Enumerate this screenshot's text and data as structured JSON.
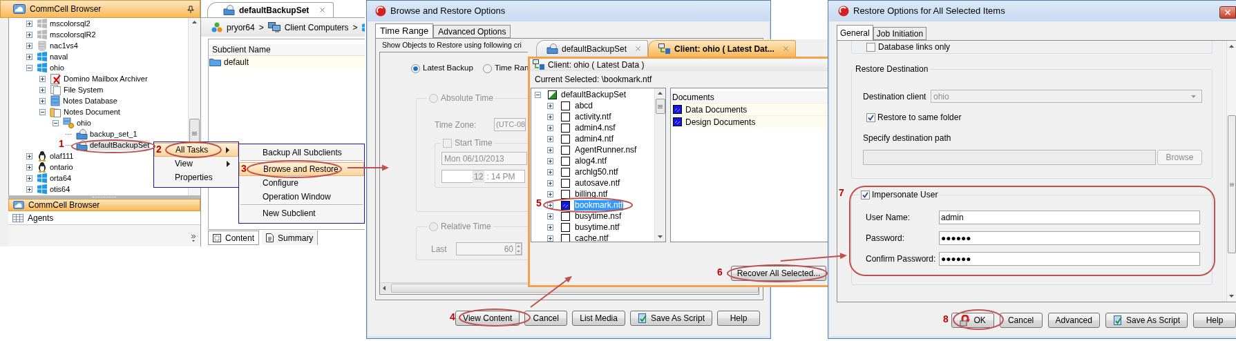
{
  "commcell_browser": {
    "title": "CommCell Browser",
    "tree": [
      {
        "label": "mscolorsql2",
        "kind": "windows-offline",
        "expandable": true,
        "expanded": false,
        "selected": false
      },
      {
        "label": "mscolorsqlR2",
        "kind": "windows-offline",
        "expandable": true,
        "expanded": false,
        "selected": false
      },
      {
        "label": "nac1vs4",
        "kind": "server",
        "expandable": true,
        "expanded": false,
        "selected": false
      },
      {
        "label": "naval",
        "kind": "windows",
        "expandable": true,
        "expanded": false,
        "selected": false
      },
      {
        "label": "ohio",
        "kind": "windows",
        "expandable": true,
        "expanded": true,
        "selected": false,
        "children": [
          {
            "label": "Domino Mailbox Archiver",
            "kind": "archiver",
            "expandable": true,
            "expanded": false,
            "selected": false
          },
          {
            "label": "File System",
            "kind": "files",
            "expandable": true,
            "expanded": false,
            "selected": false
          },
          {
            "label": "Notes Database",
            "kind": "database",
            "expandable": true,
            "expanded": false,
            "selected": false
          },
          {
            "label": "Notes Document",
            "kind": "document",
            "expandable": true,
            "expanded": true,
            "selected": false,
            "children": [
              {
                "label": "ohio",
                "kind": "instance",
                "expandable": true,
                "expanded": true,
                "selected": false,
                "children": [
                  {
                    "label": "backup_set_1",
                    "kind": "backupset",
                    "expandable": false,
                    "expanded": false,
                    "selected": false
                  },
                  {
                    "label": "defaultBackupSet",
                    "kind": "backupset",
                    "expandable": false,
                    "expanded": false,
                    "selected": true
                  }
                ]
              }
            ]
          }
        ]
      },
      {
        "label": "olaf111",
        "kind": "linux",
        "expandable": true,
        "expanded": false,
        "selected": false
      },
      {
        "label": "ontario",
        "kind": "linux",
        "expandable": true,
        "expanded": false,
        "selected": false
      },
      {
        "label": "orta64",
        "kind": "windows",
        "expandable": true,
        "expanded": false,
        "selected": false
      },
      {
        "label": "otis64",
        "kind": "windows",
        "expandable": true,
        "expanded": false,
        "selected": false
      }
    ],
    "bottom_bar_title": "CommCell Browser",
    "agents_label": "Agents"
  },
  "content_pane": {
    "tab": "defaultBackupSet",
    "breadcrumb_separator": ">",
    "breadcrumb": [
      {
        "label": "pryor64",
        "kind": "commcell"
      },
      {
        "label": "Client Computers",
        "kind": "computers"
      },
      {
        "kind": "windows"
      }
    ],
    "columns": [
      "Subclient Name"
    ],
    "rows": [
      {
        "name": "default"
      }
    ],
    "bottom_tabs": [
      {
        "label": "Content",
        "kind": "content",
        "selected": true
      },
      {
        "label": "Summary",
        "kind": "summary",
        "selected": false
      }
    ]
  },
  "context_menu": [
    {
      "label": "All Tasks",
      "submenu": true,
      "selected": true
    },
    {
      "label": "View",
      "submenu": true,
      "selected": false
    },
    {
      "label": "Properties",
      "submenu": false,
      "selected": false
    }
  ],
  "submenu": [
    {
      "kind": "item",
      "label": "Backup All Subclients",
      "selected": false
    },
    {
      "kind": "separator"
    },
    {
      "kind": "item",
      "label": "Browse and Restore",
      "selected": true
    },
    {
      "kind": "item",
      "label": "Configure",
      "selected": false
    },
    {
      "kind": "item",
      "label": "Operation Window",
      "selected": false
    },
    {
      "kind": "separator"
    },
    {
      "kind": "item",
      "label": "New Subclient",
      "selected": false
    }
  ],
  "browse_restore_dialog": {
    "title": "Browse and Restore Options",
    "tabs": [
      {
        "label": "Time Range",
        "selected": true
      },
      {
        "label": "Advanced Options",
        "selected": false
      }
    ],
    "criteria_label": "Show Objects to Restore using following cri",
    "options": [
      {
        "label": "Latest Backup",
        "selected": true
      },
      {
        "label": "Time Ran",
        "selected": false
      }
    ],
    "absolute_time": {
      "label": "Absolute Time",
      "selected": false,
      "disabled": true,
      "time_zone_label": "Time Zone:",
      "time_zone_value": "(UTC-08",
      "start_time": {
        "label": "Start Time",
        "checked": false,
        "date": "Mon 06/10/2013",
        "time_parts": [
          "12",
          ":",
          "14 PM"
        ]
      }
    },
    "relative_time": {
      "label": "Relative Time",
      "selected": false,
      "disabled": true,
      "last_label": "Last",
      "last_value": "60"
    },
    "buttons": [
      {
        "label": "View Content",
        "kind": "plain"
      },
      {
        "label": "Cancel",
        "kind": "plain"
      },
      {
        "label": "List Media",
        "kind": "plain"
      },
      {
        "label": "Save As Script",
        "kind": "script"
      },
      {
        "label": "Help",
        "kind": "plain"
      }
    ]
  },
  "browse_window": {
    "tabs": [
      {
        "label": "defaultBackupSet",
        "selected": false
      },
      {
        "label": "Client: ohio ( Latest Dat...",
        "selected": true
      }
    ],
    "header": "Client: ohio ( Latest Data )",
    "current_selected": "Current Selected: \\bookmark.ntf",
    "tree": {
      "label": "defaultBackupSet",
      "partial": true,
      "expanded": true,
      "children": [
        {
          "label": "abcd",
          "checked": false,
          "selected": false
        },
        {
          "label": "activity.ntf",
          "checked": false,
          "selected": false
        },
        {
          "label": "admin4.nsf",
          "checked": false,
          "selected": false
        },
        {
          "label": "admin4.ntf",
          "checked": false,
          "selected": false
        },
        {
          "label": "AgentRunner.nsf",
          "checked": false,
          "selected": false
        },
        {
          "label": "alog4.ntf",
          "checked": false,
          "selected": false
        },
        {
          "label": "archlg50.ntf",
          "checked": false,
          "selected": false
        },
        {
          "label": "autosave.ntf",
          "checked": false,
          "selected": false
        },
        {
          "label": "billing.ntf",
          "checked": false,
          "selected": false
        },
        {
          "label": "bookmark.ntf",
          "checked": true,
          "selected": true
        },
        {
          "label": "busytime.nsf",
          "checked": false,
          "selected": false
        },
        {
          "label": "busytime.ntf",
          "checked": false,
          "selected": false
        },
        {
          "label": "cache.ntf",
          "checked": false,
          "selected": false
        }
      ]
    },
    "documents_column": "Documents",
    "documents": [
      {
        "label": "Data Documents",
        "checked": true
      },
      {
        "label": "Design Documents",
        "checked": true
      }
    ],
    "recover_button": "Recover All Selected..."
  },
  "restore_options_dialog": {
    "title": "Restore Options for All Selected Items",
    "tabs": [
      {
        "label": "General",
        "selected": true
      },
      {
        "label": "Job Initiation",
        "selected": false
      }
    ],
    "database_links": {
      "label": "Database links only",
      "checked": false
    },
    "restore_destination": {
      "title": "Restore Destination",
      "client_label": "Destination client",
      "client_value": "ohio",
      "client_disabled": true,
      "same_folder": {
        "label": "Restore to same folder",
        "checked": true
      },
      "path_label": "Specify destination path",
      "path_disabled": true,
      "browse_button": "Browse",
      "browse_disabled": true
    },
    "impersonate": {
      "label": "Impersonate User",
      "checked": true,
      "fields": [
        {
          "label": "User Name:",
          "value": "admin"
        },
        {
          "label": "Password:",
          "value": "●●●●●●"
        },
        {
          "label": "Confirm Password:",
          "value": "●●●●●●"
        }
      ]
    },
    "buttons": [
      {
        "label": "OK",
        "kind": "ok"
      },
      {
        "label": "Cancel",
        "kind": "plain"
      },
      {
        "label": "Advanced",
        "kind": "plain"
      },
      {
        "label": "Save As Script",
        "kind": "script"
      },
      {
        "label": "Help",
        "kind": "plain"
      }
    ]
  },
  "callouts": [
    {
      "label": "1"
    },
    {
      "label": "2"
    },
    {
      "label": "3"
    },
    {
      "label": "4"
    },
    {
      "label": "5"
    },
    {
      "label": "6"
    },
    {
      "label": "7"
    },
    {
      "label": "8"
    }
  ]
}
